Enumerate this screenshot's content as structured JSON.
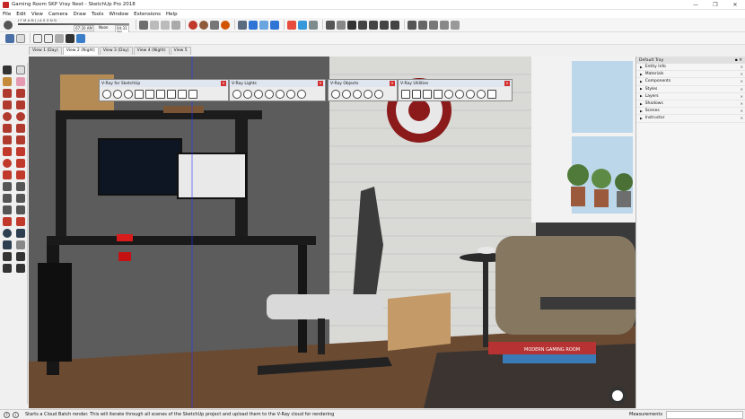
{
  "window": {
    "title": "Gaming Room SKP Vray Next - SketchUp Pro 2018",
    "minimize": "—",
    "maximize": "❐",
    "close": "✕"
  },
  "menu": [
    "File",
    "Edit",
    "View",
    "Camera",
    "Draw",
    "Tools",
    "Window",
    "Extensions",
    "Help"
  ],
  "shadow": {
    "months": "J F M A M J J A S O N D",
    "time_start": "07:20 AM",
    "noon": "Noon",
    "time_end": "04:31 PM"
  },
  "scene_tabs": [
    "View 1 (Day)",
    "View 2 (Night)",
    "View 3 (Day)",
    "View 4 (Night)",
    "View 5"
  ],
  "active_scene_index": 1,
  "vray_toolbars": [
    {
      "title": "V-Ray for SketchUp"
    },
    {
      "title": "V-Ray Lights"
    },
    {
      "title": "V-Ray Objects"
    },
    {
      "title": "V-Ray Utilities"
    }
  ],
  "tray": {
    "title": "Default Tray",
    "items": [
      "Entity Info",
      "Materials",
      "Components",
      "Styles",
      "Layers",
      "Shadows",
      "Scenes",
      "Instructor"
    ]
  },
  "book_title": "MODERN GAMING ROOM",
  "status": {
    "message": "Starts a Cloud Batch render. This will iterate through all scenes of the SketchUp project and upload them to the V-Ray cloud for rendering",
    "measurements_label": "Measurements",
    "measurements_value": ""
  },
  "colors": {
    "accent_red": "#c62828",
    "toolbar_bg": "#f5f5f5",
    "floor": "#6b4a32",
    "brick": "#d9d9d6"
  }
}
